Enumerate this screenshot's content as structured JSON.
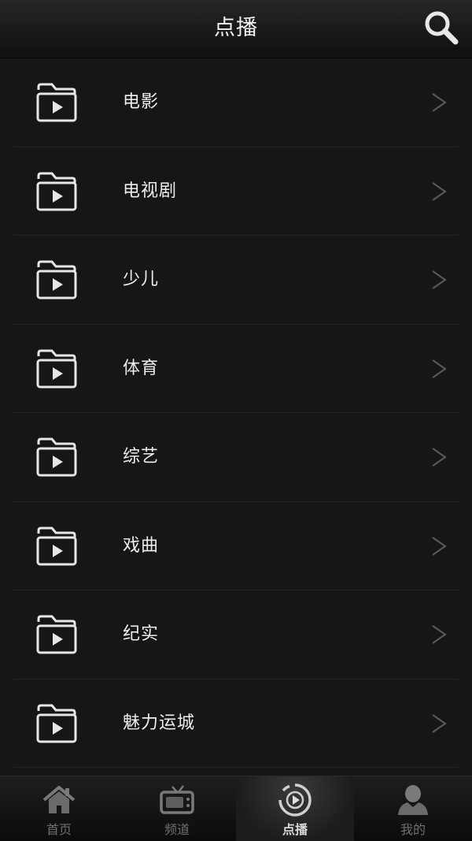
{
  "header": {
    "title": "点播",
    "search_icon": "search-icon"
  },
  "categories": [
    {
      "label": "电影",
      "icon": "folder-play-icon"
    },
    {
      "label": "电视剧",
      "icon": "folder-play-icon"
    },
    {
      "label": "少儿",
      "icon": "folder-play-icon"
    },
    {
      "label": "体育",
      "icon": "folder-play-icon"
    },
    {
      "label": "综艺",
      "icon": "folder-play-icon"
    },
    {
      "label": "戏曲",
      "icon": "folder-play-icon"
    },
    {
      "label": "纪实",
      "icon": "folder-play-icon"
    },
    {
      "label": "魅力运城",
      "icon": "folder-play-icon"
    }
  ],
  "tabbar": {
    "tabs": [
      {
        "label": "首页",
        "icon": "home-icon",
        "active": false
      },
      {
        "label": "频道",
        "icon": "tv-icon",
        "active": false
      },
      {
        "label": "点播",
        "icon": "play-circle-icon",
        "active": true
      },
      {
        "label": "我的",
        "icon": "user-icon",
        "active": false
      }
    ]
  },
  "colors": {
    "background": "#151515",
    "text": "#ededed",
    "inactive_tab": "#6f6f6f",
    "chevron": "#5a5a5a"
  }
}
